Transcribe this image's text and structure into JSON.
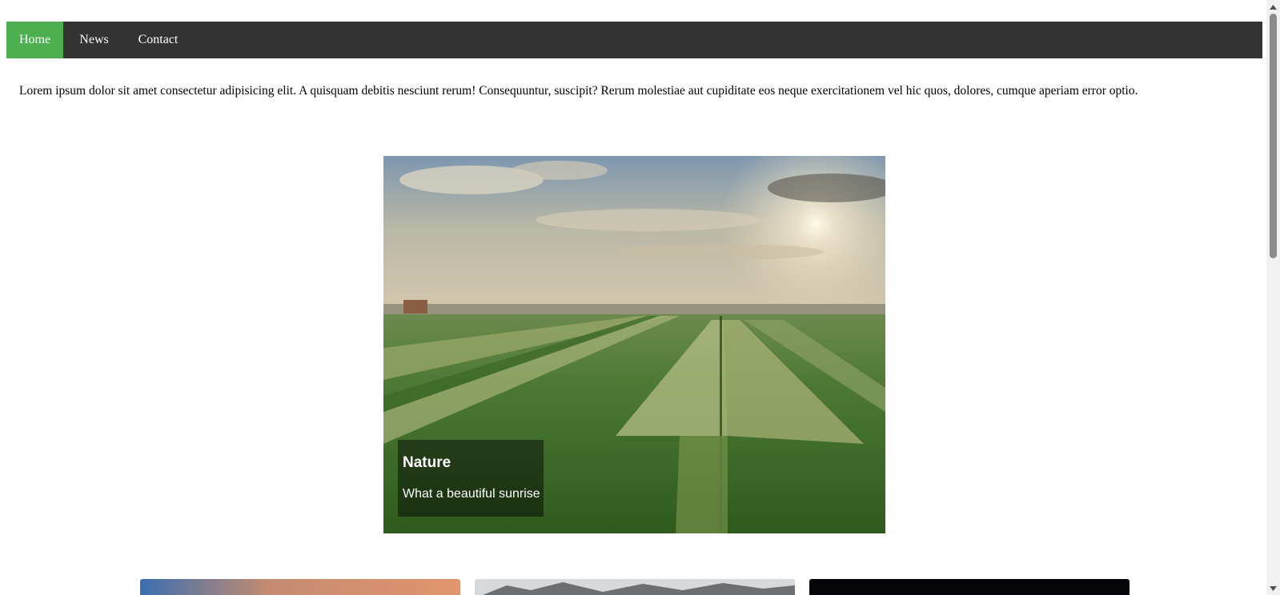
{
  "nav": {
    "items": [
      {
        "label": "Home",
        "active": true
      },
      {
        "label": "News",
        "active": false
      },
      {
        "label": "Contact",
        "active": false
      }
    ]
  },
  "intro_text": "Lorem ipsum dolor sit amet consectetur adipisicing elit. A quisquam debitis nesciunt rerum! Consequuntur, suscipit? Rerum molestiae aut cupiditate eos neque exercitationem vel hic quos, dolores, cumque aperiam error optio.",
  "hero": {
    "caption_title": "Nature",
    "caption_text": "What a beautiful sunrise",
    "image_subject": "sunrise-over-farm-fields"
  },
  "thumbnails": [
    {
      "subject": "sunset-sky"
    },
    {
      "subject": "snowy-mountains"
    },
    {
      "subject": "dark-image"
    }
  ],
  "colors": {
    "nav_bg": "#333333",
    "nav_active": "#4CAF50",
    "nav_text": "#ffffff"
  }
}
